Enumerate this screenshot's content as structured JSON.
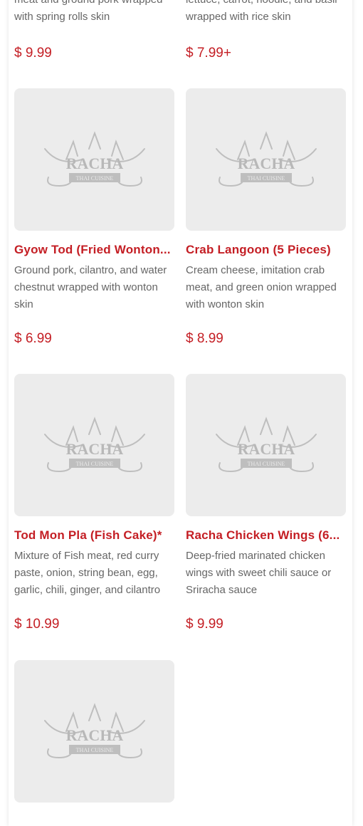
{
  "menu": {
    "partial_top": [
      {
        "desc": "meat and ground pork wrapped with spring rolls skin",
        "price": "$ 9.99"
      },
      {
        "desc": "lettuce, carrot, noodle, and basil wrapped with rice skin",
        "price": "$ 7.99+"
      }
    ],
    "items": [
      {
        "name": "Gyow Tod (Fried Wonton...",
        "desc": "Ground pork, cilantro, and water chestnut wrapped with wonton skin",
        "price": "$ 6.99"
      },
      {
        "name": "Crab Langoon (5 Pieces)",
        "desc": "Cream cheese, imitation crab meat, and green onion wrapped with wonton skin",
        "price": "$ 8.99"
      },
      {
        "name": "Tod Mon Pla (Fish Cake)*",
        "desc": "Mixture of Fish meat, red curry paste, onion, string bean, egg, garlic, chili, ginger, and cilantro",
        "price": "$ 10.99"
      },
      {
        "name": "Racha Chicken Wings (6...",
        "desc": "Deep-fried marinated chicken wings with sweet chili sauce or Sriracha sauce",
        "price": "$ 9.99"
      }
    ],
    "placeholder_logo": {
      "title": "RACHA",
      "subtitle": "THAI CUISINE"
    }
  },
  "colors": {
    "accent": "#c41e24",
    "text_muted": "#666666",
    "thumb_bg": "#ececec"
  }
}
